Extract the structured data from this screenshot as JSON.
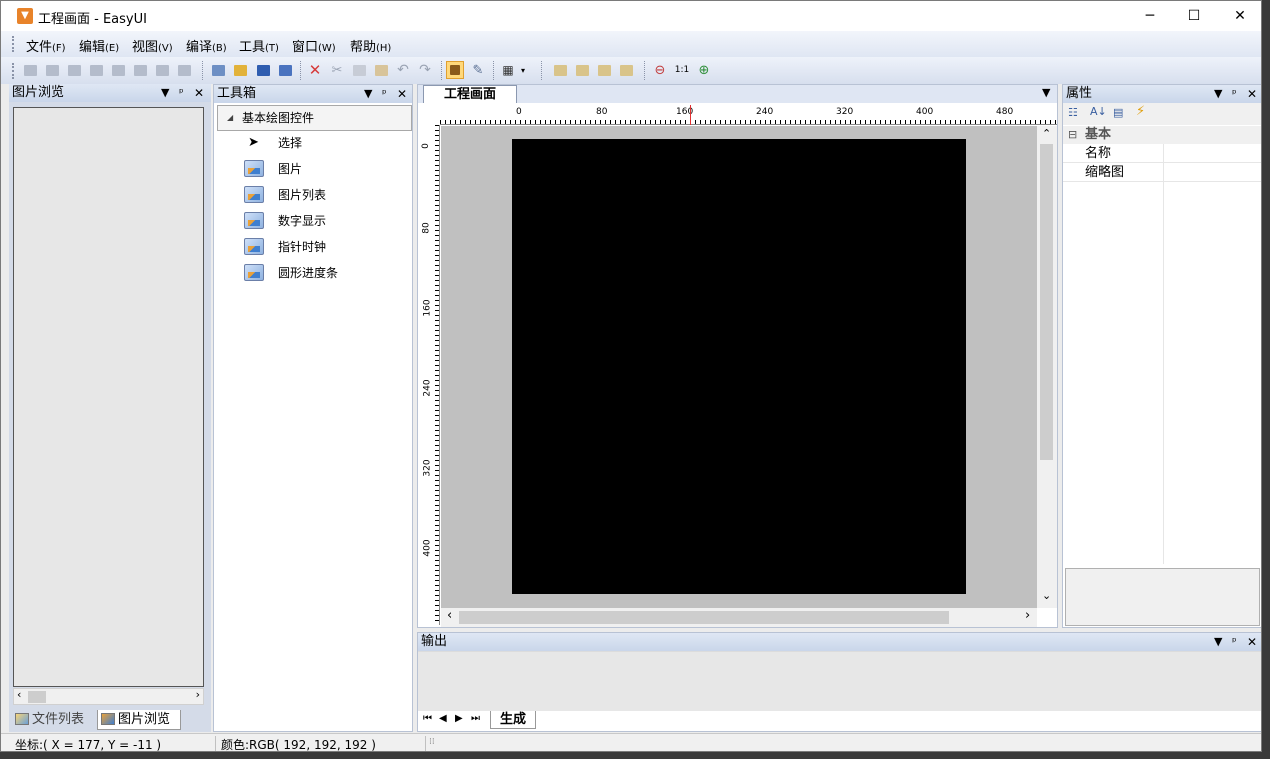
{
  "window": {
    "title": "工程画面 - EasyUI",
    "icon": "app-logo-icon"
  },
  "menu": [
    {
      "label": "文件",
      "key": "(F)"
    },
    {
      "label": "编辑",
      "key": "(E)"
    },
    {
      "label": "视图",
      "key": "(V)"
    },
    {
      "label": "编译",
      "key": "(B)"
    },
    {
      "label": "工具",
      "key": "(T)"
    },
    {
      "label": "窗口",
      "key": "(W)"
    },
    {
      "label": "帮助",
      "key": "(H)"
    }
  ],
  "image_browser": {
    "title": "图片浏览",
    "tabs": [
      "文件列表",
      "图片浏览"
    ]
  },
  "toolbox": {
    "title": "工具箱",
    "category": "基本绘图控件",
    "items": [
      "选择",
      "图片",
      "图片列表",
      "数字显示",
      "指针时钟",
      "圆形进度条"
    ]
  },
  "document": {
    "tab": "工程画面",
    "ruler_h": [
      "0",
      "80",
      "160",
      "240",
      "320",
      "400",
      "480"
    ],
    "ruler_v": [
      "0",
      "80",
      "160",
      "240",
      "320",
      "400"
    ],
    "canvas_color": "#000000",
    "background": "#c0c0c0"
  },
  "properties": {
    "title": "属性",
    "category": "基本",
    "rows": [
      "名称",
      "缩略图"
    ]
  },
  "output": {
    "title": "输出",
    "tab": "生成"
  },
  "status": {
    "coords": "坐标:( X = 177, Y = -11 )",
    "color": "颜色:RGB( 192, 192, 192 )"
  }
}
